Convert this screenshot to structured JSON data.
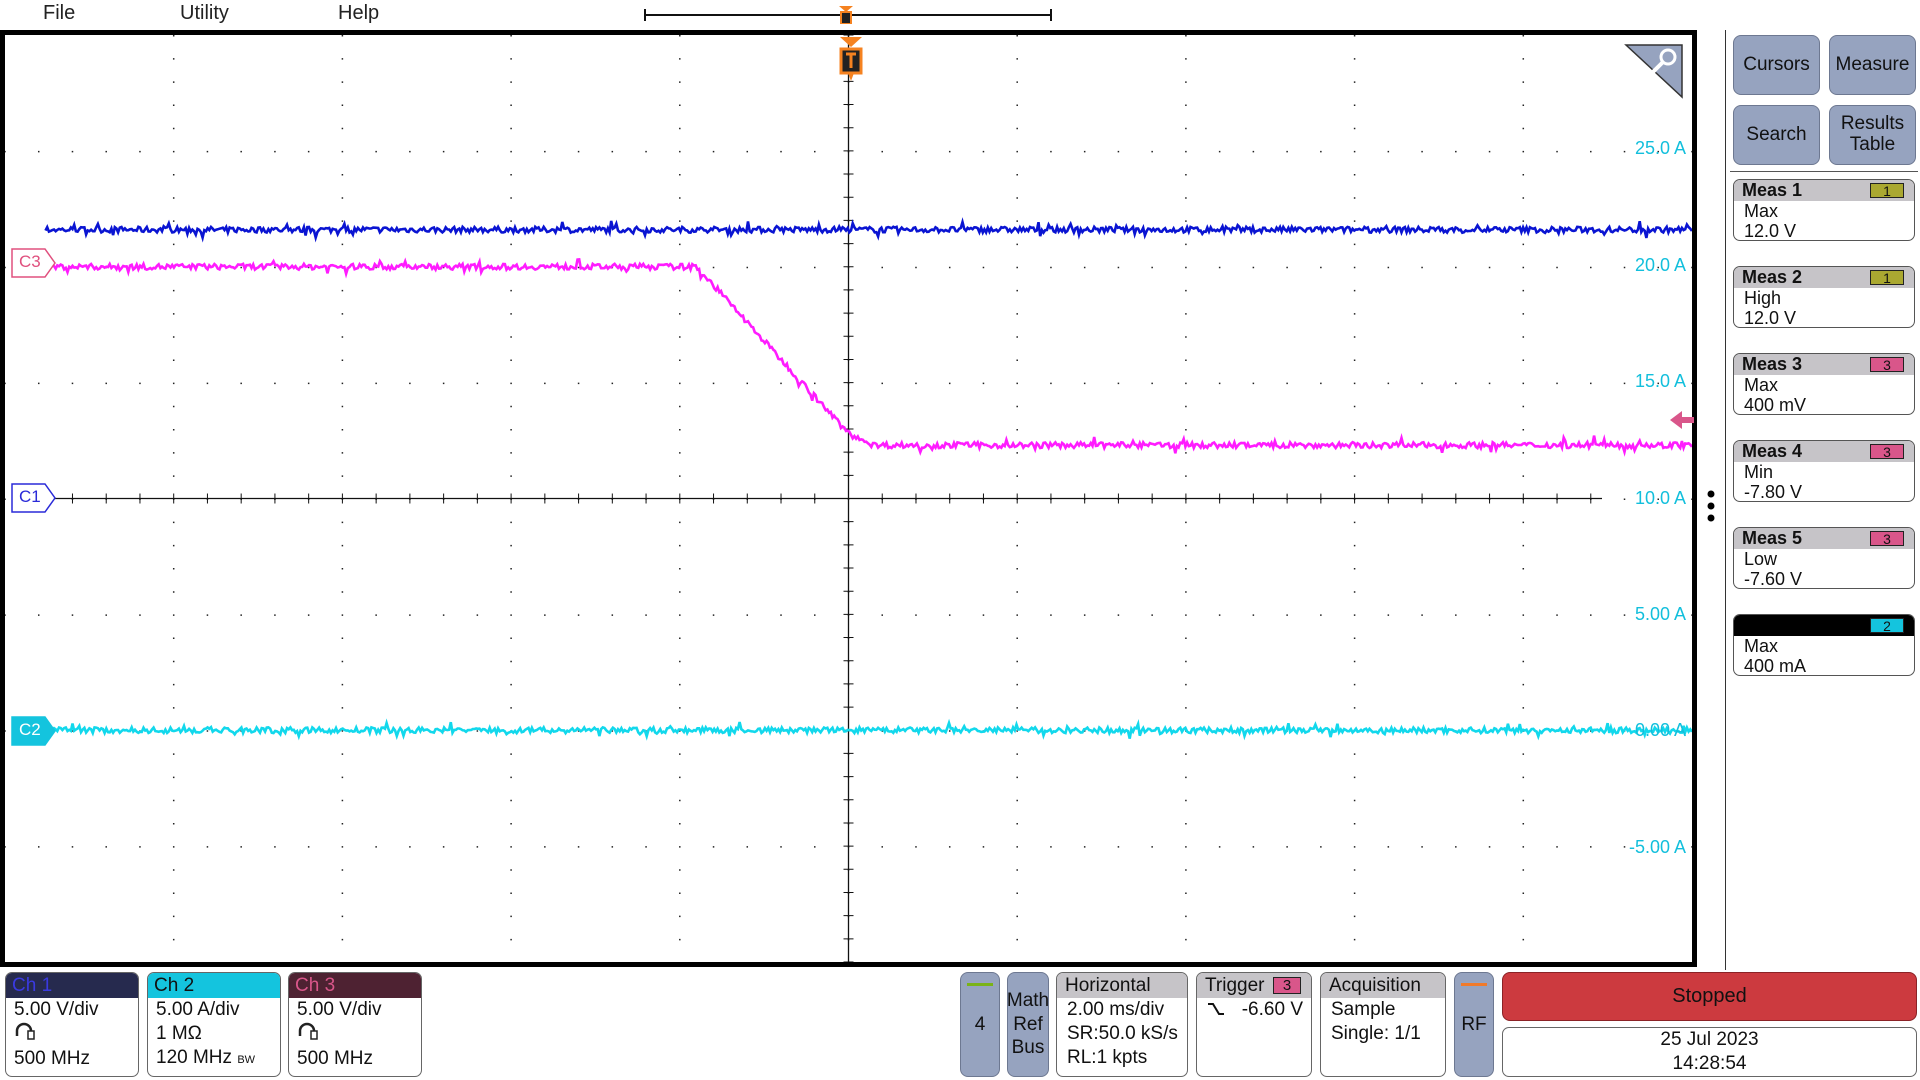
{
  "menu": {
    "file": "File",
    "utility": "Utility",
    "help": "Help"
  },
  "trigger_marker": "T",
  "y_axis_labels": [
    "25.0 A",
    "20.0 A",
    "15.0 A",
    "10.0 A",
    "5.00 A",
    "0.00 A",
    "-5.00 A"
  ],
  "channel_markers": {
    "c1": "C1",
    "c2": "C2",
    "c3": "C3"
  },
  "colors": {
    "ch1_trace": "#0a14d2",
    "ch2_trace": "#12d8ec",
    "ch3_trace": "#ff1cff",
    "ch1_header": "#262a4e",
    "ch2_header": "#14c4de",
    "ch3_header": "#4e2232",
    "trigger_accent": "#f58220",
    "stopped": "#cc3a3f",
    "button": "#96a3bf",
    "meas_ch1_badge": "#aaa831",
    "meas_ch3_badge": "#d9568a"
  },
  "waveforms": {
    "time_unit": "ms",
    "time_range": [
      -10,
      10
    ],
    "ch1": {
      "unit": "V",
      "points": [
        [
          -10,
          11.6
        ],
        [
          10,
          11.6
        ]
      ]
    },
    "ch2": {
      "unit": "A",
      "points": [
        [
          -10,
          0.0
        ],
        [
          10,
          0.0
        ]
      ]
    },
    "ch3": {
      "unit": "V",
      "points": [
        [
          -10,
          0.0
        ],
        [
          -1.8,
          0.0
        ],
        [
          0.0,
          -7.2
        ],
        [
          0.3,
          -7.7
        ],
        [
          10,
          -7.7
        ]
      ]
    }
  },
  "side_panel": {
    "cursors": "Cursors",
    "measure": "Measure",
    "search": "Search",
    "results_table": "Results Table",
    "measurements": [
      {
        "title": "Meas 1",
        "source": "1",
        "type": "Max",
        "value": "12.0 V"
      },
      {
        "title": "Meas 2",
        "source": "1",
        "type": "High",
        "value": "12.0 V"
      },
      {
        "title": "Meas 3",
        "source": "3",
        "type": "Max",
        "value": "400 mV"
      },
      {
        "title": "Meas 4",
        "source": "3",
        "type": "Min",
        "value": "-7.80 V"
      },
      {
        "title": "Meas 5",
        "source": "3",
        "type": "Low",
        "value": "-7.60 V"
      },
      {
        "title": "",
        "source": "2",
        "type": "Max",
        "value": "400 mA"
      }
    ]
  },
  "channels": [
    {
      "label": "Ch 1",
      "scale": "5.00 V/div",
      "probe_icon": "probe-icon",
      "bandwidth": "500 MHz"
    },
    {
      "label": "Ch 2",
      "scale": "5.00 A/div",
      "impedance": "1 MΩ",
      "bandwidth": "120 MHz",
      "bw_limit": "BW"
    },
    {
      "label": "Ch 3",
      "scale": "5.00 V/div",
      "probe_icon": "probe-icon",
      "bandwidth": "500 MHz"
    }
  ],
  "bottom": {
    "ch4": "4",
    "math_ref_bus": "Math Ref Bus",
    "horizontal": {
      "title": "Horizontal",
      "scale": "2.00 ms/div",
      "sample_rate": "SR:50.0 kS/s",
      "record_length": "RL:1 kpts"
    },
    "trigger": {
      "title": "Trigger",
      "source": "3",
      "slope_icon": "falling-edge-icon",
      "level": "-6.60 V"
    },
    "acquisition": {
      "title": "Acquisition",
      "mode": "Sample",
      "count": "Single: 1/1"
    },
    "rf": "RF",
    "status": "Stopped",
    "date": "25 Jul 2023",
    "time": "14:28:54"
  }
}
